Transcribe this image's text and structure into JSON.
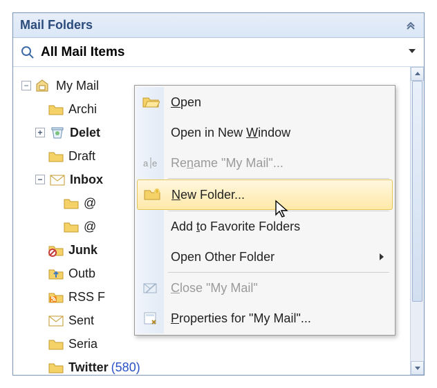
{
  "header": {
    "title": "Mail Folders"
  },
  "search": {
    "title": "All Mail Items"
  },
  "tree": {
    "my_mail": "My Mail",
    "archive": "Archi",
    "deleted": "Delet",
    "drafts": "Draft",
    "inbox": "Inbox",
    "at1": "@",
    "at2": "@",
    "junk": "Junk",
    "outbox": "Outb",
    "rss": "RSS F",
    "sent": "Sent",
    "serial": "Seria",
    "twitter": "Twitter",
    "twitter_count": "(580)"
  },
  "menu": {
    "open": "pen",
    "open_prefix": "O",
    "open_window": "Open in New ",
    "open_window_u": "W",
    "open_window_suffix": "indow",
    "rename_pre": "Re",
    "rename_u": "n",
    "rename_suf": "ame \"My Mail\"...",
    "new_folder_u": "N",
    "new_folder_suf": "ew Folder...",
    "add_fav_pre": "Add ",
    "add_fav_u": "t",
    "add_fav_suf": "o Favorite Folders",
    "open_other": "Open Other Folder",
    "close_u": "C",
    "close_suf": "lose \"My Mail\"",
    "props_u": "P",
    "props_suf": "roperties for \"My Mail\"..."
  }
}
